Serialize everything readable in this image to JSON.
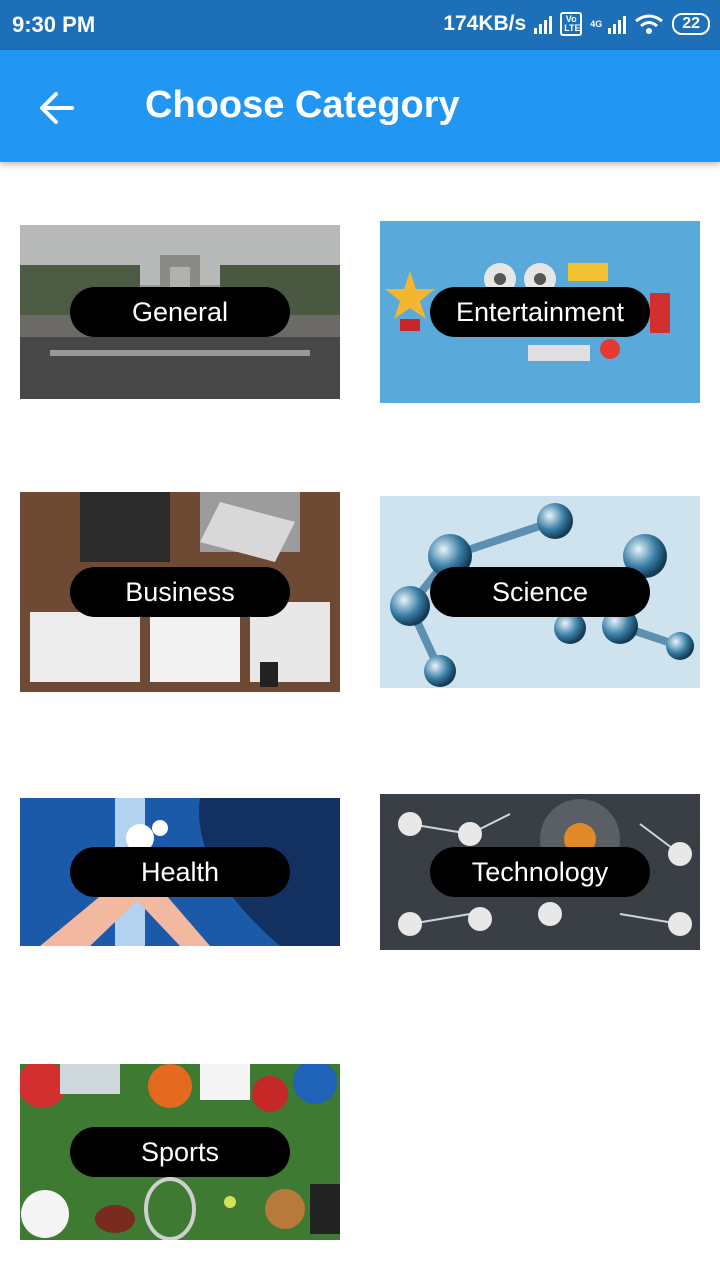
{
  "status_bar": {
    "time": "9:30 PM",
    "speed": "174KB/s",
    "volte": "Vo LTE",
    "network": "4G",
    "battery": "22"
  },
  "app_bar": {
    "back_icon": "arrow-left-icon",
    "title": "Choose Category"
  },
  "categories": [
    {
      "label": "General",
      "image": "city-road-gate-image"
    },
    {
      "label": "Entertainment",
      "image": "entertainment-icons-image"
    },
    {
      "label": "Business",
      "image": "business-desk-image"
    },
    {
      "label": "Science",
      "image": "molecule-image"
    },
    {
      "label": "Health",
      "image": "handwashing-image"
    },
    {
      "label": "Technology",
      "image": "tech-network-image"
    },
    {
      "label": "Sports",
      "image": "sports-equipment-image"
    }
  ],
  "colors": {
    "status_bar": "#1d6fb8",
    "app_bar": "#2196f3",
    "pill": "#000000"
  }
}
